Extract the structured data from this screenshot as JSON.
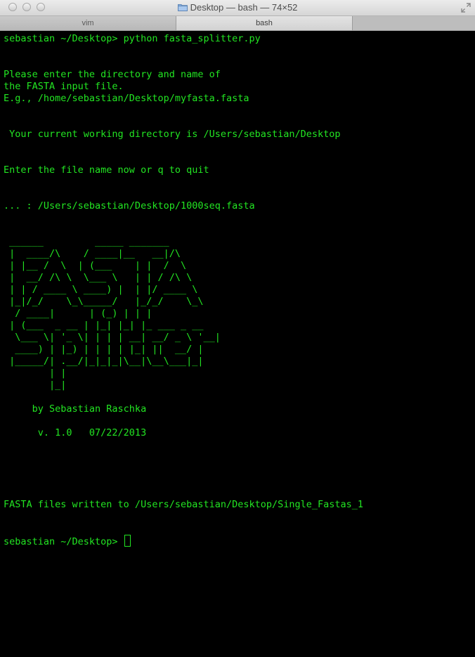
{
  "window": {
    "title": "Desktop — bash — 74×52",
    "folder_icon": "folder-icon",
    "fullscreen_icon": "fullscreen-icon"
  },
  "tabs": [
    {
      "label": "vim"
    },
    {
      "label": "bash"
    }
  ],
  "terminal": {
    "text_color": "#22e522",
    "background": "#000000",
    "lines": [
      "sebastian ~/Desktop> python fasta_splitter.py",
      "",
      "",
      "Please enter the directory and name of",
      "the FASTA input file.",
      "E.g., /home/sebastian/Desktop/myfasta.fasta",
      "",
      "",
      " Your current working directory is /Users/sebastian/Desktop",
      "",
      "",
      "Enter the file name now or q to quit",
      "",
      "",
      "... : /Users/sebastian/Desktop/1000seq.fasta",
      "",
      "",
      " ______         _____ _______",
      " |  ____/\\    / ____|__   __|/\\",
      " | |__ /  \\  | (___    | |  /  \\",
      " |  __/ /\\ \\  \\___ \\   | | / /\\ \\",
      " | | / ____ \\ ____) |  | |/ ____ \\",
      " |_|/_/    \\_\\_____/   |_/_/    \\_\\",
      "  / ____|      | (_) | | |",
      " | (___  _ __ | |_| |_| |_ ___ _ __",
      "  \\___ \\| '_ \\| | | | __| __/ _ \\ '__|",
      "  ____) | |_) | | | | |_| ||  __/ |",
      " |_____/| .__/|_|_|_|\\__|\\__\\___|_|",
      "        | |",
      "        |_|",
      "",
      "     by Sebastian Raschka",
      "",
      "      v. 1.0   07/22/2013",
      "",
      "",
      "",
      "",
      "",
      "FASTA files written to /Users/sebastian/Desktop/Single_Fastas_1",
      "",
      "",
      "sebastian ~/Desktop> "
    ]
  }
}
